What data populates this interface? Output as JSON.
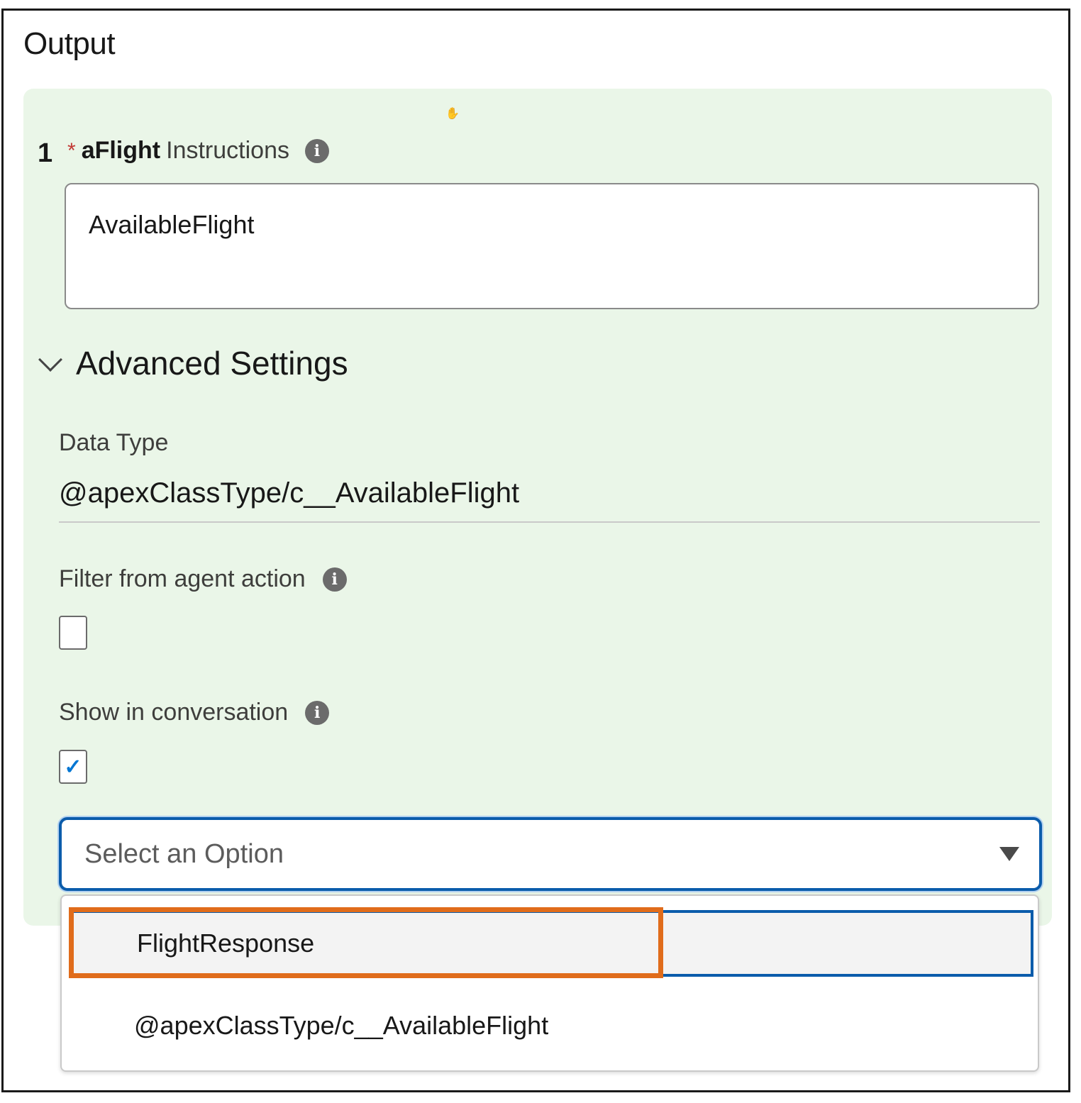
{
  "section": {
    "title": "Output"
  },
  "output_item": {
    "number": "1",
    "required_mark": "*",
    "label_strong": "aFlight",
    "label_rest": "Instructions",
    "instructions_value": "AvailableFlight"
  },
  "advanced_settings": {
    "title": "Advanced Settings",
    "expanded": true,
    "data_type_label": "Data Type",
    "data_type_value": "@apexClassType/c__AvailableFlight",
    "filter_label": "Filter from agent action",
    "filter_checked": false,
    "show_label": "Show in conversation",
    "show_checked": true,
    "show_check_glyph": "✓"
  },
  "combobox": {
    "placeholder": "Select an Option",
    "options": [
      {
        "label": "FlightResponse",
        "highlighted": true
      },
      {
        "label": "@apexClassType/c__AvailableFlight",
        "highlighted": false
      }
    ]
  },
  "icons": {
    "info": "info-icon",
    "chevron": "chevron-down-icon",
    "caret": "caret-down-icon",
    "check": "check-icon"
  },
  "colors": {
    "panel_bg": "#eaf6e8",
    "required": "#c23934",
    "focus_border": "#0b5cab",
    "check": "#0176d3",
    "annotation_highlight": "#e06c1b"
  }
}
